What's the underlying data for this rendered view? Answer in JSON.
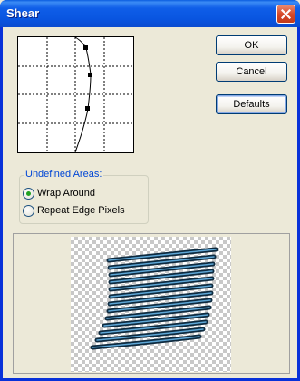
{
  "window": {
    "title": "Shear"
  },
  "buttons": {
    "ok": "OK",
    "cancel": "Cancel",
    "defaults": "Defaults"
  },
  "undefined_areas": {
    "label": "Undefined Areas:",
    "options": [
      {
        "label": "Wrap Around",
        "selected": true
      },
      {
        "label": "Repeat Edge Pixels",
        "selected": false
      }
    ]
  },
  "icons": {
    "close": "close-icon"
  },
  "colors": {
    "title_bar": "#0a5ddf",
    "radio_selected": "#21a121",
    "group_label": "#0046d5",
    "preview_stripe": "#1f5d86"
  }
}
